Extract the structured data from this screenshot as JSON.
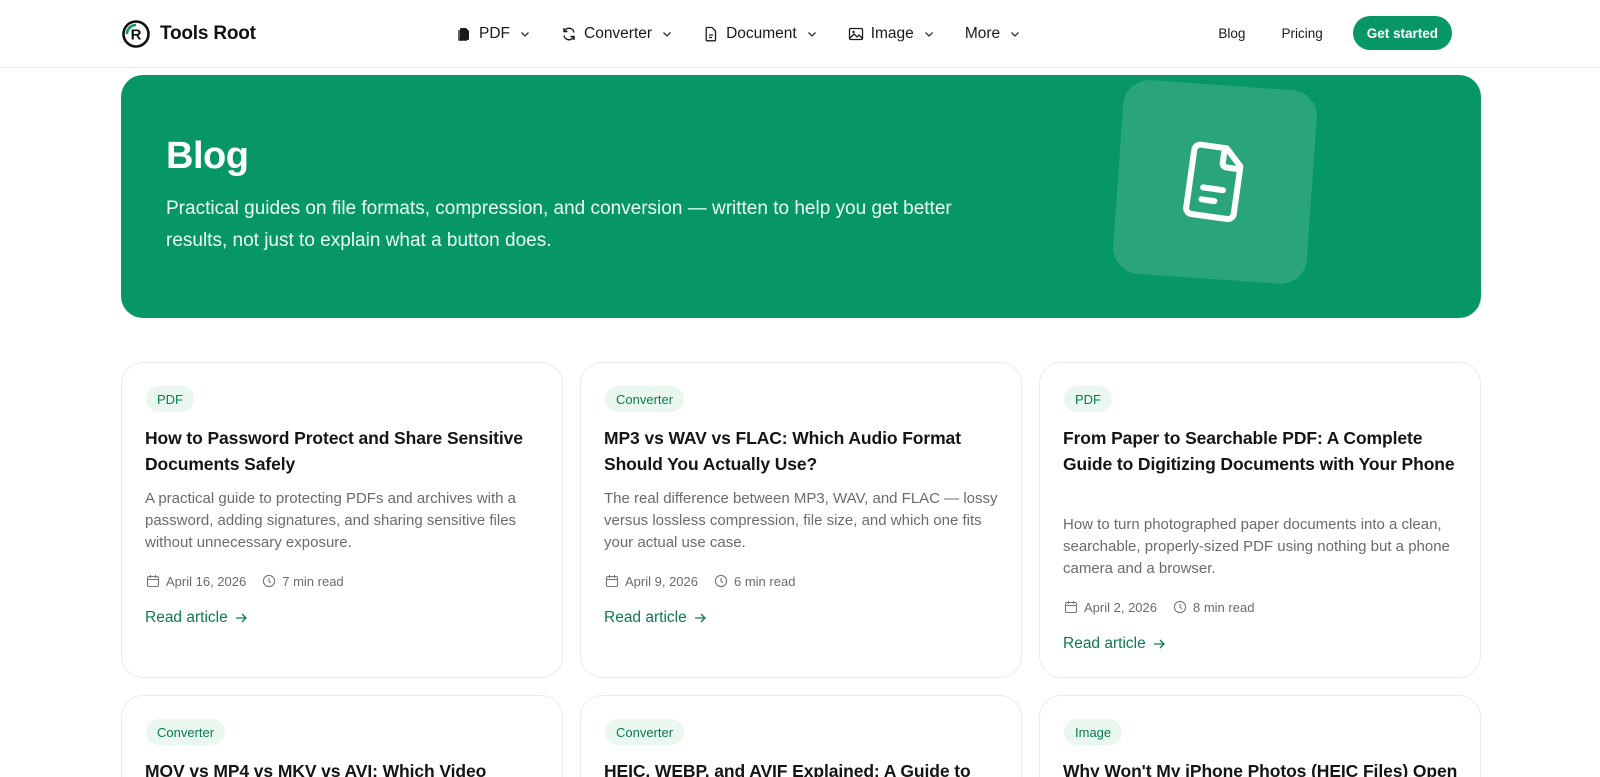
{
  "brand": {
    "name": "Tools Root",
    "color": "#079766"
  },
  "nav": {
    "items": [
      {
        "label": "PDF",
        "icon": "files-icon"
      },
      {
        "label": "Converter",
        "icon": "refresh-icon"
      },
      {
        "label": "Document",
        "icon": "document-icon"
      },
      {
        "label": "Image",
        "icon": "image-icon"
      },
      {
        "label": "More",
        "icon": ""
      }
    ],
    "blog": "Blog",
    "pricing": "Pricing",
    "cta": "Get started"
  },
  "hero": {
    "title": "Blog",
    "subtitle": "Practical guides on file formats, compression, and conversion — written to help you get better results, not just to explain what a button does.",
    "icon": "document-icon"
  },
  "posts": [
    {
      "tag": "PDF",
      "title": "How to Password Protect and Share Sensitive Documents Safely",
      "desc": "A practical guide to protecting PDFs and archives with a password, adding signatures, and sharing sensitive files without unnecessary exposure.",
      "date": "April 16, 2026",
      "read_time": "7 min read",
      "link": "Read article"
    },
    {
      "tag": "Converter",
      "title": "MP3 vs WAV vs FLAC: Which Audio Format Should You Actually Use?",
      "desc": "The real difference between MP3, WAV, and FLAC — lossy versus lossless compression, file size, and which one fits your actual use case.",
      "date": "April 9, 2026",
      "read_time": "6 min read",
      "link": "Read article"
    },
    {
      "tag": "PDF",
      "title": "From Paper to Searchable PDF: A Complete Guide to Digitizing Documents with Your Phone",
      "desc": "How to turn photographed paper documents into a clean, searchable, properly-sized PDF using nothing but a phone camera and a browser.",
      "date": "April 2, 2026",
      "read_time": "8 min read",
      "link": "Read article"
    },
    {
      "tag": "Converter",
      "title": "MOV vs MP4 vs MKV vs AVI: Which Video"
    },
    {
      "tag": "Converter",
      "title": "HEIC, WEBP, and AVIF Explained: A Guide to"
    },
    {
      "tag": "Image",
      "title": "Why Won't My iPhone Photos (HEIC Files) Open"
    }
  ]
}
